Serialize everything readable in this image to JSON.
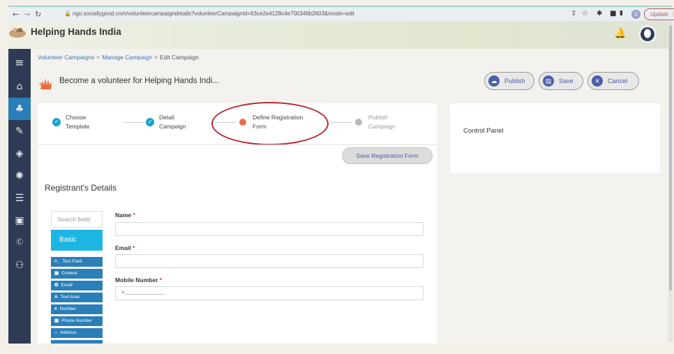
{
  "browser": {
    "url": "ngo.sociallygood.com/volunteercampaigndetails?volunteerCampaignId=63ce2e4128c4e700346b2603&mode=edit",
    "profile_initial": "S",
    "update_label": "Update"
  },
  "header": {
    "brand": "Helping Hands India"
  },
  "breadcrumb": {
    "items": [
      "Volunteer Campaigns",
      "Manage Campaign",
      "Edit Campaign"
    ],
    "separator": "<"
  },
  "campaign": {
    "title": "Become a volunteer for Helping Hands Indi..."
  },
  "actions": {
    "publish": "Publish",
    "save": "Save",
    "cancel": "Cancel"
  },
  "stepper": {
    "steps": [
      {
        "line1": "Choose",
        "line2": "Template",
        "state": "done"
      },
      {
        "line1": "Detail",
        "line2": "Campaign",
        "state": "done"
      },
      {
        "line1": "Define Registration",
        "line2": "Form",
        "state": "active"
      },
      {
        "line1": "Publish",
        "line2": "Campaign",
        "state": "todo"
      }
    ]
  },
  "form_builder": {
    "save_form": "Save Registration Form",
    "section_title": "Registrant's Details",
    "search_placeholder": "Search field(",
    "category": "Basic",
    "field_types": [
      {
        "glyph": ">_",
        "label": "Text Field"
      },
      {
        "glyph": "▣",
        "label": "Content"
      },
      {
        "glyph": "✪",
        "label": "Email"
      },
      {
        "glyph": "A",
        "label": "Text Area"
      },
      {
        "glyph": "#",
        "label": "Number"
      },
      {
        "glyph": "▣",
        "label": "Phone Number"
      },
      {
        "glyph": "⌂",
        "label": "Address"
      }
    ],
    "fields": [
      {
        "label": "Name",
        "required": "*",
        "value": ""
      },
      {
        "label": "Email",
        "required": "*",
        "value": ""
      },
      {
        "label": "Mobile Number",
        "required": "*",
        "value": "+____________"
      }
    ]
  },
  "control_panel": {
    "title": "Control Panel"
  },
  "colors": {
    "sidebar": "#2f3b55",
    "accent": "#1db6e3",
    "field_button": "#2a7fb8",
    "active_step": "#f06c47",
    "annotation": "#b7282e"
  }
}
